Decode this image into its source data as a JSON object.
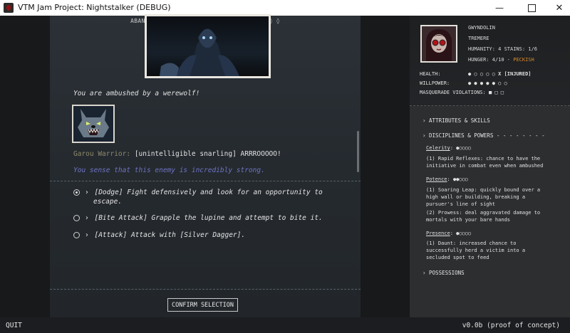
{
  "window": {
    "title": "VTM Jam Project: Nightstalker (DEBUG)",
    "minimize": "—",
    "close": "✕"
  },
  "scene": {
    "location": "ABANDONED MILL, EXTERIOR - MIDNIGHT ◊ ◊ ◊",
    "ambush_text": "You are ambushed by a werewolf!",
    "speaker": "Garou Warrior:",
    "speech": "[unintelligible snarling] ARRROOOOO!",
    "sense_text": "You sense that this enemy is incredibly strong."
  },
  "choices": [
    {
      "chevron": "›",
      "line1": "[Dodge] Fight defensively and look for an opportunity to",
      "line2": "escape.",
      "selected": true
    },
    {
      "chevron": "›",
      "line1": "[Bite Attack] Grapple the lupine and attempt to bite it.",
      "line2": "",
      "selected": false
    },
    {
      "chevron": "›",
      "line1": "[Attack] Attack with [Silver Dagger].",
      "line2": "",
      "selected": false
    }
  ],
  "confirm_label": "CONFIRM SELECTION",
  "character": {
    "name": "GWYNDOLIN",
    "clan": "TREMERE",
    "humanity_stains": "HUMANITY: 4  STAINS: 1/6",
    "hunger_prefix": "HUNGER: 4/10 -",
    "hunger_state": "PECKISH",
    "health_label": "HEALTH:",
    "health_dots": "● ○ ○ ○ ○",
    "health_x": "X",
    "health_status": "[INJURED]",
    "willpower_label": "WILLPOWER:",
    "willpower_dots": "● ● ● ● ● ○ ○",
    "masquerade_label": "MASQUERADE VIOLATIONS:",
    "masquerade_boxes": "■ □ □"
  },
  "sections": {
    "attributes": "› ATTRIBUTES & SKILLS",
    "disciplines": "› DISCIPLINES & POWERS - - - - - - - -",
    "possessions": "› POSSESSIONS"
  },
  "disciplines": [
    {
      "name": "Celerity",
      "dots": ": ●○○○○",
      "powers": [
        {
          "lines": [
            "(1) Rapid Reflexes: chance to have the",
            "initiative in combat even when ambushed"
          ]
        }
      ]
    },
    {
      "name": "Potence",
      "dots": ": ●●○○○",
      "powers": [
        {
          "lines": [
            "(1) Soaring Leap: quickly bound over a",
            "high wall or building, breaking a",
            "pursuer's line of sight"
          ]
        },
        {
          "lines": [
            "(2) Prowess: deal aggravated damage to",
            "mortals with your bare hands"
          ]
        }
      ]
    },
    {
      "name": "Presence",
      "dots": ": ●○○○○",
      "powers": [
        {
          "lines": [
            "(1) Daunt: increased chance to",
            "successfully herd a victim into a",
            "secluded spot to feed"
          ]
        }
      ]
    }
  ],
  "footer": {
    "quit": "QUIT",
    "version": "v0.0b (proof of concept)"
  },
  "colors": {
    "accent_peckish": "#d88a2c",
    "sense_text": "#6f74c4",
    "speaker": "#8e8a6a"
  },
  "icons": {
    "app": "vampire-blood-icon",
    "minimize": "minimize-icon",
    "maximize": "maximize-icon",
    "close": "close-icon"
  }
}
